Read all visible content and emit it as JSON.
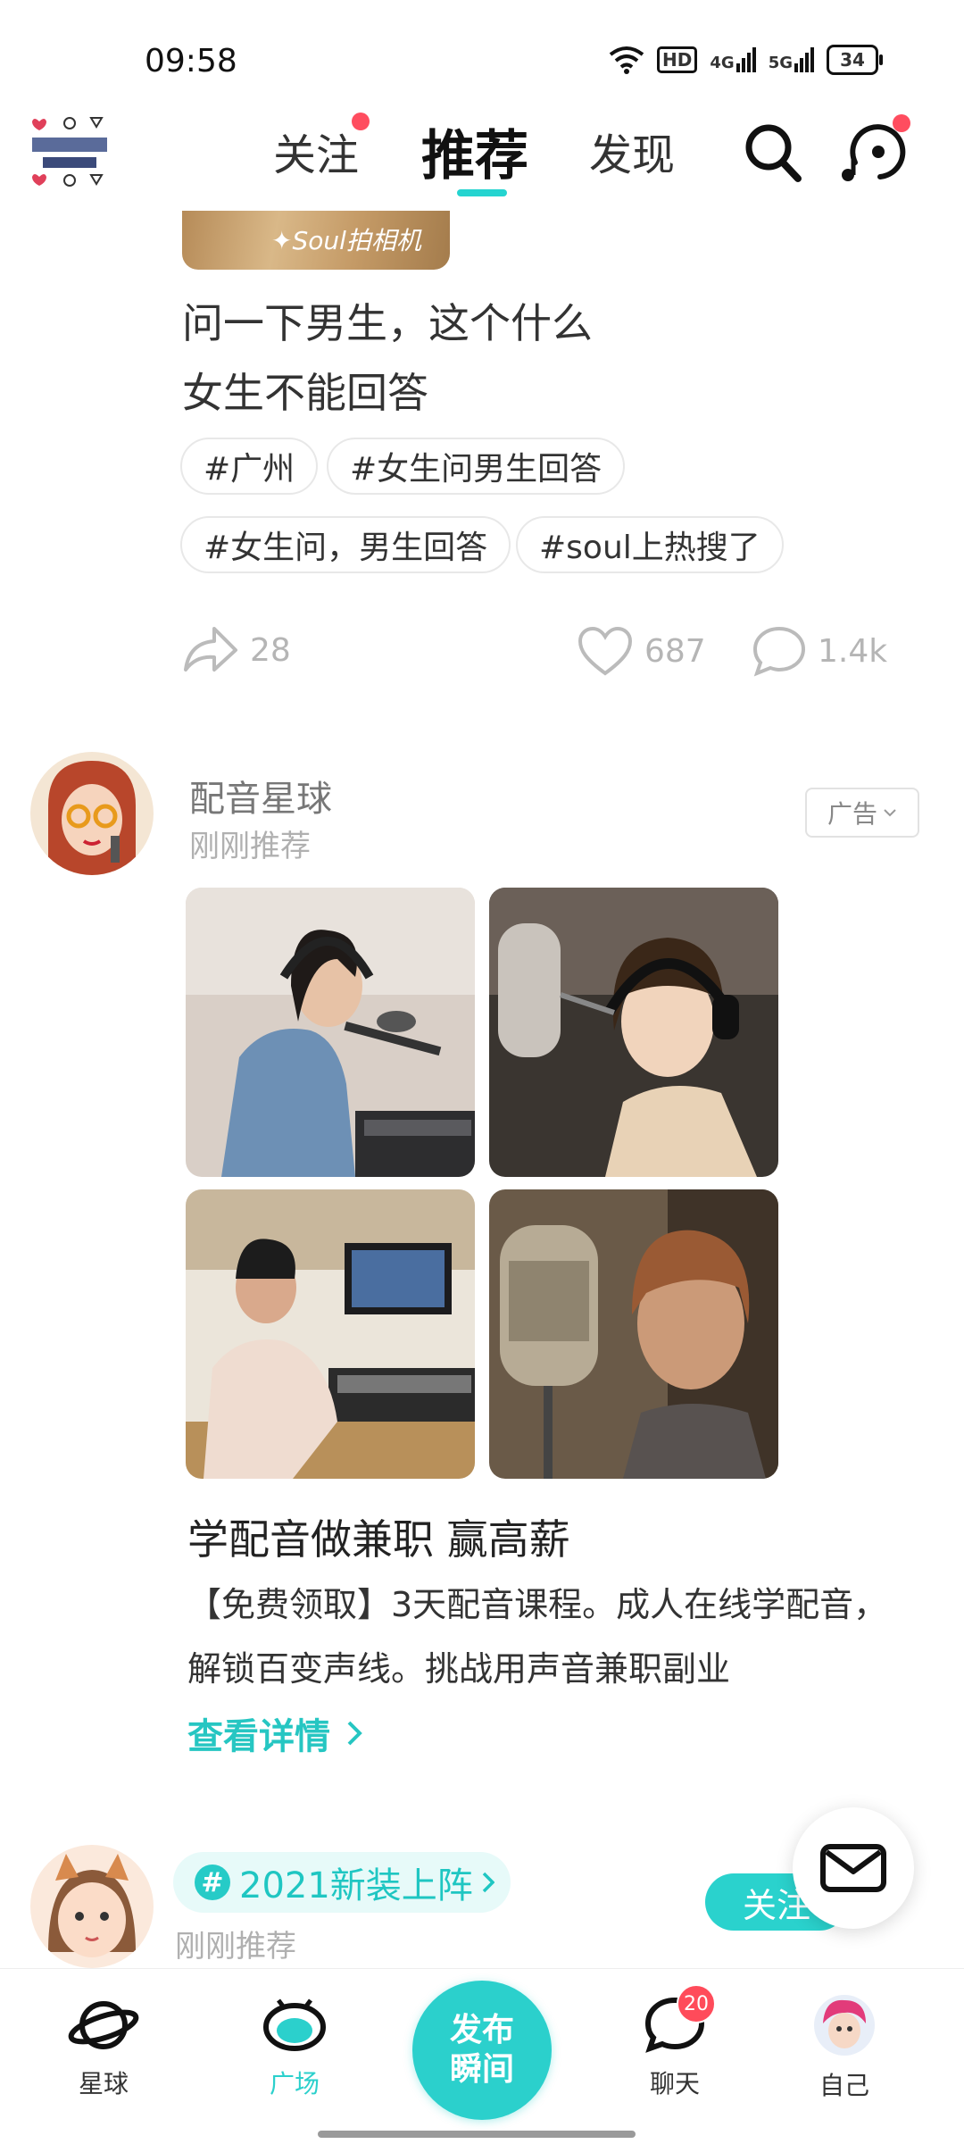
{
  "status_bar": {
    "time": "09:58",
    "network_hd": "HD",
    "network_4g": "4G",
    "network_5g": "5G",
    "battery": "34"
  },
  "top_nav": {
    "tabs": [
      {
        "label": "关注",
        "badge": true
      },
      {
        "label": "推荐",
        "active": true
      },
      {
        "label": "发现"
      }
    ]
  },
  "post1": {
    "photo_label": "✦Soul拍相机",
    "text_lines": [
      "问一下男生，这个什么",
      "女生不能回答"
    ],
    "tags": [
      "#广州",
      "#女生问男生回答",
      "#女生问，男生回答",
      "#soul上热搜了"
    ],
    "share_count": "28",
    "like_count": "687",
    "comment_count": "1.4k"
  },
  "ad_post": {
    "author": "配音星球",
    "subtitle": "刚刚推荐",
    "badge": "广告",
    "title": "学配音做兼职 赢高薪",
    "desc_lines": [
      "【免费领取】3天配音课程。成人在线学配音，",
      "解锁百变声线。挑战用声音兼职副业"
    ],
    "link": "查看详情"
  },
  "post3": {
    "topic": "2021新装上阵",
    "subtitle": "刚刚推荐",
    "follow": "关注"
  },
  "bottom_nav": {
    "items": [
      {
        "label": "星球"
      },
      {
        "label": "广场",
        "active": true
      },
      {
        "label": "聊天",
        "badge": "20"
      },
      {
        "label": "自己"
      }
    ],
    "publish_line1": "发布",
    "publish_line2": "瞬间"
  },
  "colors": {
    "accent": "#2BD0CC",
    "badge_red": "#FF4D5F"
  }
}
